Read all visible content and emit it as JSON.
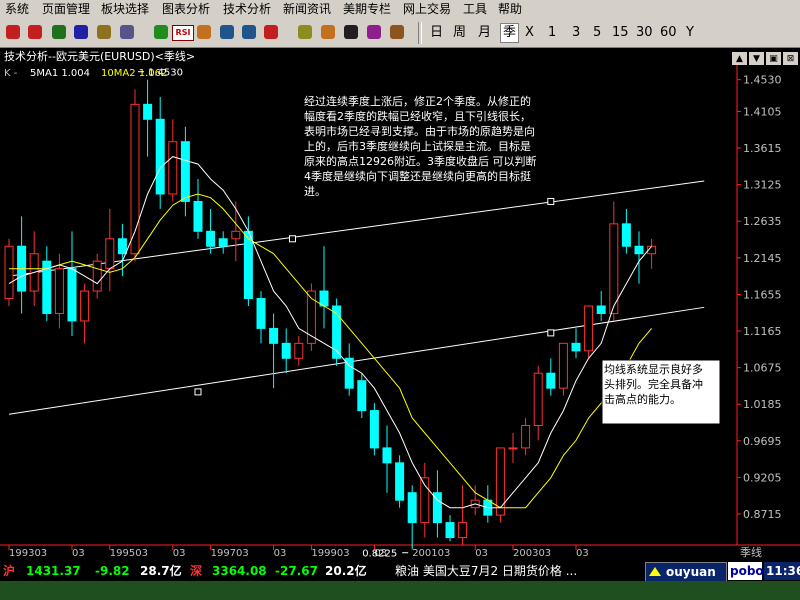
{
  "menu": [
    "系统",
    "页面管理",
    "板块选择",
    "图表分析",
    "技术分析",
    "新闻资讯",
    "美期专栏",
    "网上交易",
    "工具",
    "帮助"
  ],
  "toolbar": {
    "icons": [
      "stock-icon",
      "line-icon",
      "chart-icon",
      "table-icon",
      "book-icon",
      "report-icon",
      "refresh-icon",
      "rsi-icon",
      "f-icon",
      "zoom-in-icon",
      "zoom-out-icon",
      "alert-icon",
      "gear-icon",
      "pencil-icon",
      "radiation-icon",
      "note-icon",
      "cube-icon"
    ],
    "rsi_label": "RSI",
    "periods": [
      "日",
      "周",
      "月",
      "季",
      "X",
      "1",
      "3",
      "5",
      "15",
      "30",
      "60",
      "Y"
    ],
    "selected_period": "季"
  },
  "window": {
    "title": "技术分析--欧元美元(EURUSD)<季线>",
    "controls": [
      "▲",
      "▼",
      "▣",
      "⊠"
    ]
  },
  "indicator": {
    "k_label": "K -",
    "ma1": "5MA1 1.004",
    "ma2": "10MA2 1.062",
    "ma1_color": "#ffffff",
    "ma2_color": "#ffff00"
  },
  "annotations": {
    "main_text": "经过连续季度上涨后，修正2个季度。从修正的幅度看2季度的跌幅已经收窄，且下引线很长，表明市场已经寻到支撑。由于市场的原趋势是向上的，后市3季度继续向上试探是主流。目标是原来的高点12926附近。3季度收盘后 可以判断4季度是继续向下调整还是继续向更高的目标挺进。",
    "box_text": "均线系统显示良好多头排列。完全具备冲击高点的能力。",
    "high_label": "1.4530",
    "low_label": "0.8225"
  },
  "statusbar": {
    "sh_label": "沪",
    "sh_index": "1431.37",
    "sh_change": "-9.82",
    "sh_amount": "28.7亿",
    "sz_label": "深",
    "sz_index": "3364.08",
    "sz_change": "-27.67",
    "sz_amount": "20.2亿",
    "news": "粮油 美国大豆7月2 日期货价格 ...",
    "user": "ouyuan",
    "brand": "pobo",
    "time": "11:36"
  },
  "chart_data": {
    "type": "candlestick",
    "title": "技术分析--欧元美元(EURUSD)<季线>",
    "period_label": "季线",
    "ylim": [
      0.83,
      1.47
    ],
    "y_ticks": [
      1.453,
      1.4105,
      1.3615,
      1.3125,
      1.2635,
      1.2145,
      1.1655,
      1.1165,
      1.0675,
      1.0185,
      0.9695,
      0.9205,
      0.8715
    ],
    "x_tick_labels": [
      {
        "label": "199303",
        "index": 0
      },
      {
        "label": "03",
        "index": 5
      },
      {
        "label": "199503",
        "index": 8
      },
      {
        "label": "03",
        "index": 13
      },
      {
        "label": "199703",
        "index": 16
      },
      {
        "label": "03",
        "index": 21
      },
      {
        "label": "199903",
        "index": 24
      },
      {
        "label": "03",
        "index": 29
      },
      {
        "label": "200103",
        "index": 32
      },
      {
        "label": "03",
        "index": 37
      },
      {
        "label": "200303",
        "index": 40
      },
      {
        "label": "03",
        "index": 45
      }
    ],
    "candles": [
      {
        "o": 1.16,
        "h": 1.24,
        "c": 1.23,
        "l": 1.15
      },
      {
        "o": 1.23,
        "h": 1.27,
        "c": 1.17,
        "l": 1.14
      },
      {
        "o": 1.17,
        "h": 1.25,
        "c": 1.22,
        "l": 1.15
      },
      {
        "o": 1.21,
        "h": 1.23,
        "c": 1.14,
        "l": 1.13
      },
      {
        "o": 1.14,
        "h": 1.22,
        "c": 1.2,
        "l": 1.12
      },
      {
        "o": 1.2,
        "h": 1.25,
        "c": 1.13,
        "l": 1.11
      },
      {
        "o": 1.13,
        "h": 1.18,
        "c": 1.17,
        "l": 1.1
      },
      {
        "o": 1.17,
        "h": 1.22,
        "c": 1.21,
        "l": 1.16
      },
      {
        "o": 1.2,
        "h": 1.28,
        "c": 1.24,
        "l": 1.17
      },
      {
        "o": 1.24,
        "h": 1.26,
        "c": 1.22,
        "l": 1.19
      },
      {
        "o": 1.22,
        "h": 1.44,
        "c": 1.42,
        "l": 1.21
      },
      {
        "o": 1.42,
        "h": 1.453,
        "c": 1.4,
        "l": 1.35
      },
      {
        "o": 1.4,
        "h": 1.43,
        "c": 1.3,
        "l": 1.28
      },
      {
        "o": 1.3,
        "h": 1.4,
        "c": 1.37,
        "l": 1.29
      },
      {
        "o": 1.37,
        "h": 1.39,
        "c": 1.29,
        "l": 1.27
      },
      {
        "o": 1.29,
        "h": 1.32,
        "c": 1.25,
        "l": 1.24
      },
      {
        "o": 1.25,
        "h": 1.28,
        "c": 1.23,
        "l": 1.22
      },
      {
        "o": 1.24,
        "h": 1.25,
        "c": 1.23,
        "l": 1.22
      },
      {
        "o": 1.24,
        "h": 1.29,
        "c": 1.25,
        "l": 1.21
      },
      {
        "o": 1.25,
        "h": 1.27,
        "c": 1.16,
        "l": 1.15
      },
      {
        "o": 1.16,
        "h": 1.17,
        "c": 1.12,
        "l": 1.1
      },
      {
        "o": 1.12,
        "h": 1.14,
        "c": 1.1,
        "l": 1.04
      },
      {
        "o": 1.1,
        "h": 1.12,
        "c": 1.08,
        "l": 1.06
      },
      {
        "o": 1.08,
        "h": 1.11,
        "c": 1.1,
        "l": 1.07
      },
      {
        "o": 1.1,
        "h": 1.18,
        "c": 1.17,
        "l": 1.09
      },
      {
        "o": 1.17,
        "h": 1.23,
        "c": 1.15,
        "l": 1.12
      },
      {
        "o": 1.15,
        "h": 1.16,
        "c": 1.08,
        "l": 1.07
      },
      {
        "o": 1.08,
        "h": 1.1,
        "c": 1.04,
        "l": 1.03
      },
      {
        "o": 1.05,
        "h": 1.06,
        "c": 1.01,
        "l": 1.0
      },
      {
        "o": 1.01,
        "h": 1.02,
        "c": 0.96,
        "l": 0.95
      },
      {
        "o": 0.96,
        "h": 0.99,
        "c": 0.94,
        "l": 0.9
      },
      {
        "o": 0.94,
        "h": 0.95,
        "c": 0.89,
        "l": 0.88
      },
      {
        "o": 0.9,
        "h": 0.91,
        "c": 0.86,
        "l": 0.825
      },
      {
        "o": 0.86,
        "h": 0.94,
        "c": 0.92,
        "l": 0.84
      },
      {
        "o": 0.9,
        "h": 0.93,
        "c": 0.86,
        "l": 0.84
      },
      {
        "o": 0.86,
        "h": 0.87,
        "c": 0.84,
        "l": 0.835
      },
      {
        "o": 0.84,
        "h": 0.91,
        "c": 0.86,
        "l": 0.83
      },
      {
        "o": 0.88,
        "h": 0.91,
        "c": 0.89,
        "l": 0.87
      },
      {
        "o": 0.89,
        "h": 0.91,
        "c": 0.87,
        "l": 0.86
      },
      {
        "o": 0.87,
        "h": 0.96,
        "c": 0.96,
        "l": 0.86
      },
      {
        "o": 0.96,
        "h": 0.98,
        "c": 0.96,
        "l": 0.94
      },
      {
        "o": 0.96,
        "h": 1.0,
        "c": 0.99,
        "l": 0.95
      },
      {
        "o": 0.99,
        "h": 1.07,
        "c": 1.06,
        "l": 0.97
      },
      {
        "o": 1.06,
        "h": 1.08,
        "c": 1.04,
        "l": 1.03
      },
      {
        "o": 1.04,
        "h": 1.1,
        "c": 1.1,
        "l": 1.03
      },
      {
        "o": 1.1,
        "h": 1.12,
        "c": 1.09,
        "l": 1.08
      },
      {
        "o": 1.09,
        "h": 1.15,
        "c": 1.15,
        "l": 1.08
      },
      {
        "o": 1.15,
        "h": 1.17,
        "c": 1.14,
        "l": 1.13
      },
      {
        "o": 1.14,
        "h": 1.29,
        "c": 1.26,
        "l": 1.13
      },
      {
        "o": 1.26,
        "h": 1.28,
        "c": 1.23,
        "l": 1.22
      },
      {
        "o": 1.23,
        "h": 1.25,
        "c": 1.22,
        "l": 1.18
      },
      {
        "o": 1.22,
        "h": 1.24,
        "c": 1.23,
        "l": 1.2
      }
    ],
    "ma5": [
      1.18,
      1.19,
      1.195,
      1.2,
      1.205,
      1.2,
      1.19,
      1.18,
      1.2,
      1.21,
      1.25,
      1.3,
      1.335,
      1.35,
      1.345,
      1.34,
      1.32,
      1.305,
      1.28,
      1.25,
      1.21,
      1.17,
      1.15,
      1.12,
      1.11,
      1.1,
      1.09,
      1.07,
      1.06,
      1.04,
      1.01,
      0.98,
      0.94,
      0.91,
      0.89,
      0.88,
      0.88,
      0.885,
      0.88,
      0.88,
      0.9,
      0.92,
      0.94,
      0.98,
      1.01,
      1.05,
      1.08,
      1.1,
      1.15,
      1.18,
      1.21,
      1.23
    ],
    "ma10": [
      1.2,
      1.2,
      1.2,
      1.2,
      1.205,
      1.21,
      1.205,
      1.2,
      1.195,
      1.2,
      1.215,
      1.24,
      1.265,
      1.285,
      1.295,
      1.3,
      1.295,
      1.28,
      1.26,
      1.24,
      1.23,
      1.22,
      1.2,
      1.18,
      1.16,
      1.15,
      1.14,
      1.12,
      1.1,
      1.08,
      1.06,
      1.04,
      1.0,
      0.98,
      0.96,
      0.94,
      0.92,
      0.9,
      0.89,
      0.88,
      0.88,
      0.88,
      0.9,
      0.92,
      0.95,
      0.97,
      1.0,
      1.02,
      1.05,
      1.07,
      1.1,
      1.12
    ],
    "trendlines": [
      {
        "x1": 0,
        "y1": 1.19,
        "x2": 52,
        "y2": 1.31
      },
      {
        "x1": 0,
        "y1": 1.005,
        "x2": 52,
        "y2": 1.14
      }
    ],
    "trend_markers": [
      {
        "i": 22.5,
        "v": 1.24
      },
      {
        "i": 43,
        "v": 1.29
      },
      {
        "i": 15,
        "v": 1.035
      },
      {
        "i": 43,
        "v": 1.114
      }
    ]
  },
  "colors": {
    "up_candle": "#ff3030",
    "down_candle": "#00ffff",
    "ma5": "#ffffff",
    "ma10": "#ffff00",
    "trendline": "#ffffff",
    "axis": "#ff2020",
    "axis_text": "#c0c0c0",
    "menu_bg": "#d4d0c8",
    "sh_change": "#00ff00",
    "status_white": "#ffffff",
    "user_bg": "#0a246a"
  }
}
